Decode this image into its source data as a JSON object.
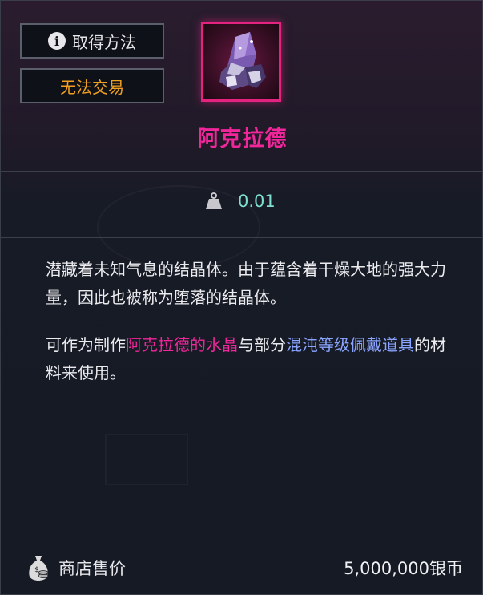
{
  "buttons": {
    "acquire_label": "取得方法",
    "trade_label": "无法交易"
  },
  "item": {
    "name": "阿克拉德",
    "icon": "purple-crystal-icon",
    "rarity_color": "#f0269a",
    "weight": "0.01"
  },
  "description": {
    "line1": "潜藏着未知气息的结晶体。由于蕴含着干燥大地的强大力量，因此也被称为堕落的结晶体。",
    "line2_pre": "可作为制作",
    "line2_hl1": "阿克拉德的水晶",
    "line2_mid": "与部分",
    "line2_hl2": "混沌等级佩戴道具",
    "line2_post": "的材料来使用。"
  },
  "shop": {
    "label": "商店售价",
    "price": "5,000,000银币"
  },
  "colors": {
    "trade_text": "#f0a020",
    "weight_text": "#7fe0d2",
    "highlight_pink": "#f0269a",
    "highlight_blue": "#8aa4ff"
  }
}
